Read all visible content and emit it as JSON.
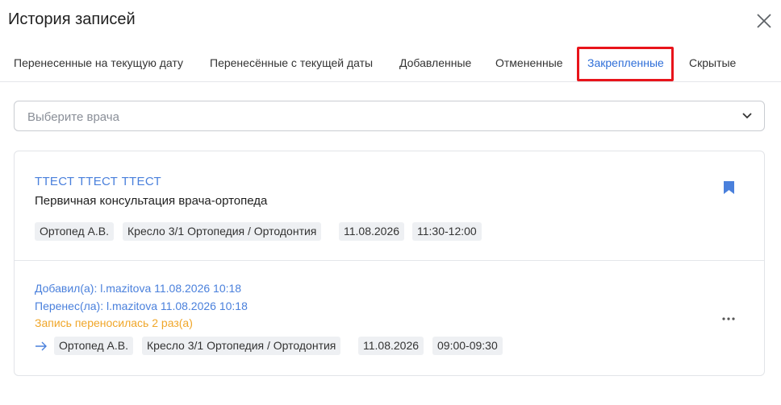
{
  "modal": {
    "title": "История записей"
  },
  "tabs": [
    {
      "label": "Перенесенные на текущую дату"
    },
    {
      "label": "Перенесённые с текущей даты"
    },
    {
      "label": "Добавленные"
    },
    {
      "label": "Отмененные"
    },
    {
      "label": "Закрепленные",
      "active": true
    },
    {
      "label": "Скрытые"
    }
  ],
  "doctor_select": {
    "placeholder": "Выберите врача"
  },
  "record": {
    "patient": "ТТЕСТ ТТЕСТ ТТЕСТ",
    "service": "Первичная консультация врача-ортопеда",
    "tags": [
      "Ортопед А.В.",
      "Кресло 3/1 Ортопедия / Ортодонтия",
      "11.08.2026",
      "11:30-12:00"
    ],
    "history": {
      "added": "Добавил(а): l.mazitova 11.08.2026 10:18",
      "moved": "Перенес(ла): l.mazitova 11.08.2026 10:18",
      "moved_count": "Запись переносилась 2 раз(а)",
      "previous_tags": [
        "Ортопед А.В.",
        "Кресло 3/1 Ортопедия / Ортодонтия",
        "11.08.2026",
        "09:00-09:30"
      ]
    }
  },
  "colors": {
    "accent": "#4a80dc",
    "active_tab": "#2f6fd8",
    "warning": "#f0a629",
    "highlight_box": "#e8141b"
  },
  "icons": {
    "close": "close-icon",
    "chevron": "chevron-down-icon",
    "bookmark": "bookmark-icon",
    "arrow": "arrow-right-icon",
    "more": "more-horizontal-icon"
  }
}
